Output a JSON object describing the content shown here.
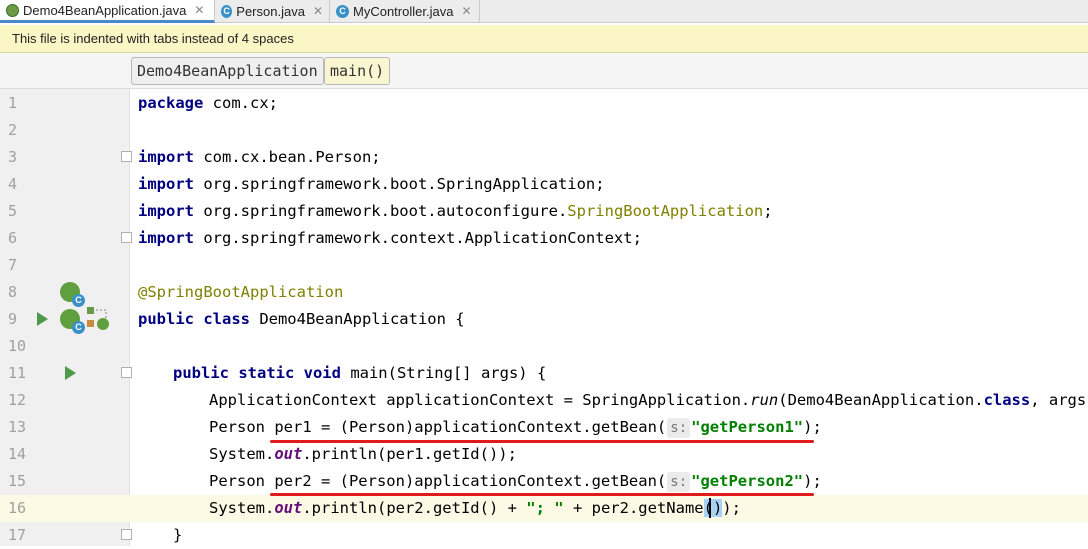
{
  "tabs": [
    {
      "label": "Demo4BeanApplication.java",
      "icon": "spring-boot-icon",
      "close": "✕",
      "active": true
    },
    {
      "label": "Person.java",
      "icon": "class-icon",
      "close": "✕",
      "active": false
    },
    {
      "label": "MyController.java",
      "icon": "class-icon",
      "close": "✕",
      "active": false
    }
  ],
  "banner": {
    "text": "This file is indented with tabs instead of 4 spaces"
  },
  "breadcrumb": {
    "class_name": "Demo4BeanApplication",
    "method": "main()"
  },
  "editor": {
    "line_numbers": [
      "1",
      "2",
      "3",
      "4",
      "5",
      "6",
      "7",
      "8",
      "9",
      "10",
      "11",
      "12",
      "13",
      "14",
      "15",
      "16",
      "17"
    ],
    "code": {
      "l1": {
        "kw": "package",
        "rest": " com.cx;"
      },
      "l3": {
        "kw": "import",
        "rest": " com.cx.bean.Person;"
      },
      "l4": {
        "kw": "import",
        "rest": " org.springframework.boot.SpringApplication;"
      },
      "l5": {
        "kw": "import",
        "rest": " org.springframework.boot.autoconfigure.",
        "ann": "SpringBootApplication",
        "tail": ";"
      },
      "l6": {
        "kw": "import",
        "rest": " org.springframework.context.ApplicationContext;"
      },
      "l8": {
        "ann": "@SpringBootApplication"
      },
      "l9": {
        "kw": "public class",
        "rest": " Demo4BeanApplication {"
      },
      "l11": {
        "kw": "public static void",
        "rest": " main(String[] args) {"
      },
      "l12": {
        "a": "ApplicationContext applicationContext = SpringApplication.",
        "it": "run",
        "b": "(Demo4BeanApplication.",
        "kw": "class",
        "c": ", args);"
      },
      "l13": {
        "a": "Person per1 = (Person)applicationContext.getBean(",
        "hint": "s:",
        "str": "\"getPerson1\"",
        "c": ");"
      },
      "l14": {
        "a": "System.",
        "fld": "out",
        "b": ".println(per1.getId());"
      },
      "l15": {
        "a": "Person per2 = (Person)applicationContext.getBean(",
        "hint": "s:",
        "str": "\"getPerson2\"",
        "c": ");"
      },
      "l16": {
        "a": "System.",
        "fld": "out",
        "b": ".println(per2.getId() + ",
        "str": "\"; \"",
        "c": " + per2.getName",
        "sel": "()",
        "d": ");"
      },
      "l17": {
        "a": "}"
      }
    }
  },
  "colors": {
    "keyword": "#000080",
    "annotation": "#808000",
    "string": "#008000",
    "underline": "#e01b1b",
    "selection": "#a8d1f5"
  }
}
